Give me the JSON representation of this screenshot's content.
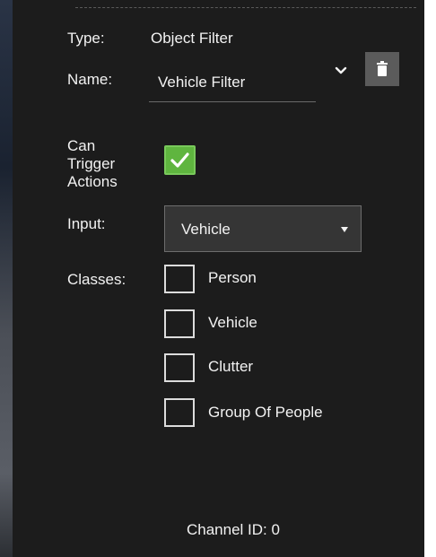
{
  "type_row": {
    "label": "Type:",
    "value": "Object Filter"
  },
  "name_row": {
    "label": "Name:",
    "value": "Vehicle Filter"
  },
  "trigger_row": {
    "label_lines": [
      "Can",
      "Trigger",
      "Actions"
    ],
    "checked": true
  },
  "input_row": {
    "label": "Input:",
    "selected": "Vehicle"
  },
  "classes_row": {
    "label": "Classes:",
    "options": [
      {
        "label": "Person",
        "checked": false
      },
      {
        "label": "Vehicle",
        "checked": false
      },
      {
        "label": "Clutter",
        "checked": false
      },
      {
        "label": "Group Of People",
        "checked": false
      }
    ]
  },
  "footer": {
    "channel_text": "Channel ID: 0"
  },
  "icons": {
    "collapse": "chevron-down-icon",
    "delete": "trash-icon",
    "checked": "checkmark-icon",
    "dropdown": "caret-down-icon"
  },
  "colors": {
    "panel_bg": "#1c1c1c",
    "accent_green": "#5fb53f",
    "button_gray": "#5b5b5b"
  }
}
